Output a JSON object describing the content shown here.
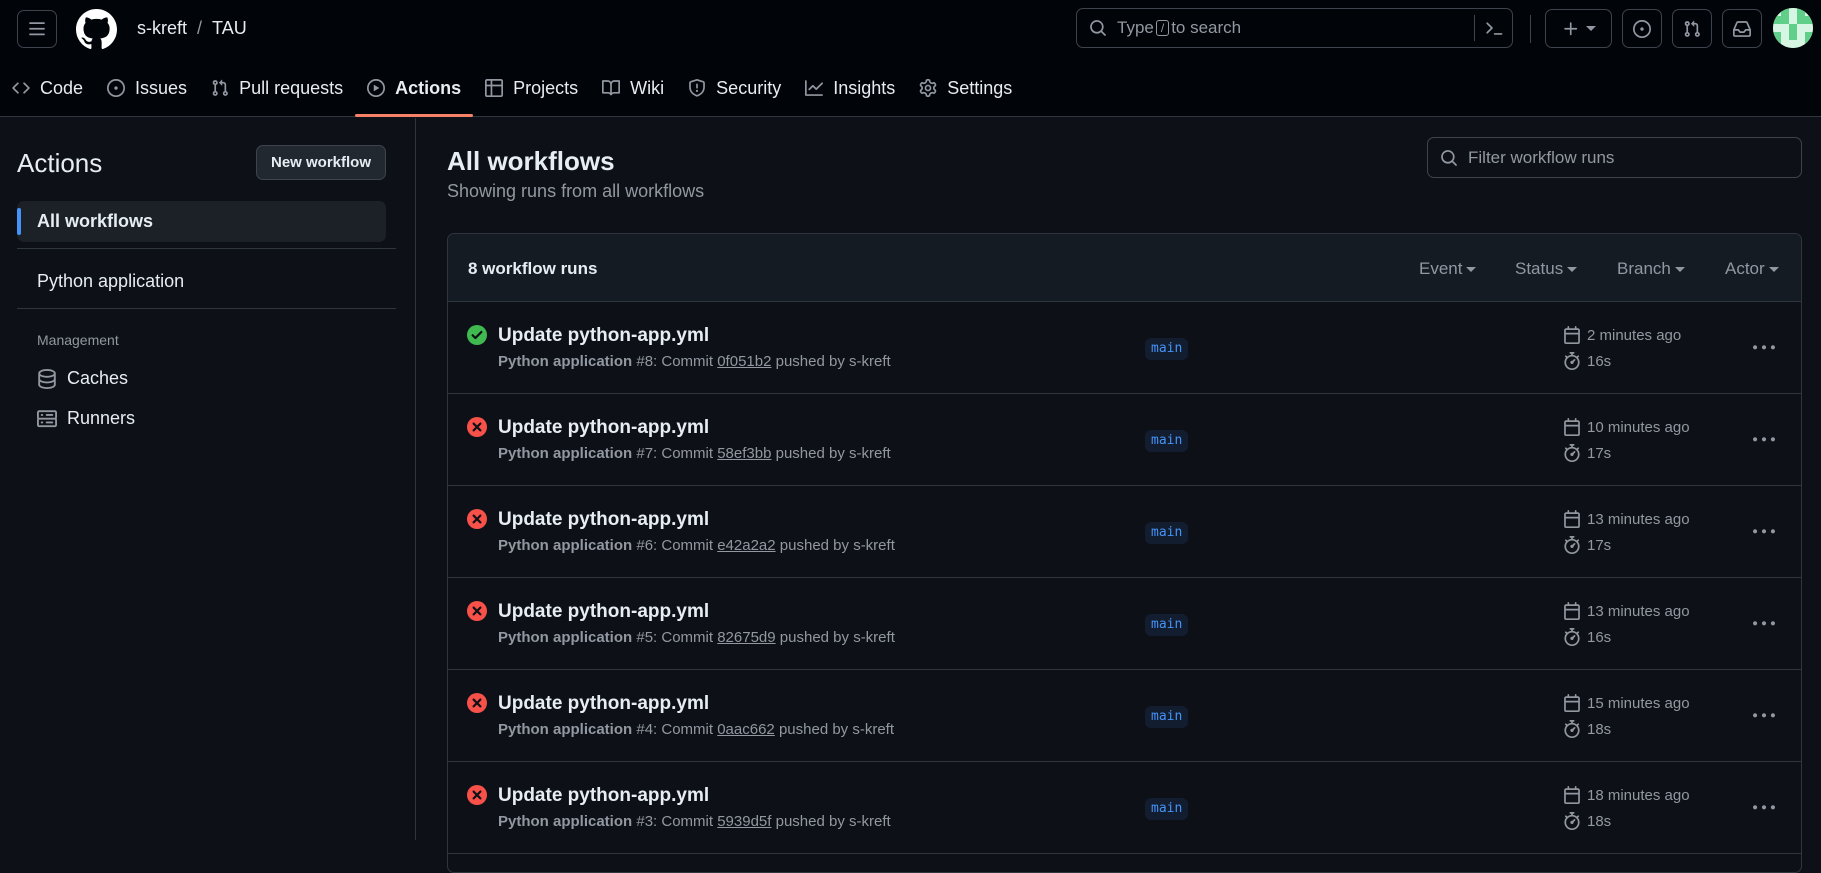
{
  "header": {
    "owner": "s-kreft",
    "separator": "/",
    "repo": "TAU",
    "search_prefix": "Type",
    "search_key": "/",
    "search_suffix": "to search"
  },
  "tabs": [
    {
      "label": "Code",
      "icon": "code-icon"
    },
    {
      "label": "Issues",
      "icon": "issue-icon"
    },
    {
      "label": "Pull requests",
      "icon": "pull-request-icon"
    },
    {
      "label": "Actions",
      "icon": "play-icon",
      "active": true
    },
    {
      "label": "Projects",
      "icon": "table-icon"
    },
    {
      "label": "Wiki",
      "icon": "book-icon"
    },
    {
      "label": "Security",
      "icon": "shield-icon"
    },
    {
      "label": "Insights",
      "icon": "graph-icon"
    },
    {
      "label": "Settings",
      "icon": "gear-icon"
    }
  ],
  "sidebar": {
    "title": "Actions",
    "new_workflow": "New workflow",
    "all_workflows": "All workflows",
    "workflow": "Python application",
    "management_label": "Management",
    "caches": "Caches",
    "runners": "Runners"
  },
  "main": {
    "title": "All workflows",
    "subtitle": "Showing runs from all workflows",
    "filter_placeholder": "Filter workflow runs",
    "runs_count": "8 workflow runs",
    "filters": [
      "Event",
      "Status",
      "Branch",
      "Actor"
    ]
  },
  "runs": [
    {
      "status": "success",
      "title": "Update python-app.yml",
      "workflow": "Python application",
      "number": "#8",
      "commit": "0f051b2",
      "actor": "s-kreft",
      "branch": "main",
      "when": "2 minutes ago",
      "duration": "16s"
    },
    {
      "status": "failure",
      "title": "Update python-app.yml",
      "workflow": "Python application",
      "number": "#7",
      "commit": "58ef3bb",
      "actor": "s-kreft",
      "branch": "main",
      "when": "10 minutes ago",
      "duration": "17s"
    },
    {
      "status": "failure",
      "title": "Update python-app.yml",
      "workflow": "Python application",
      "number": "#6",
      "commit": "e42a2a2",
      "actor": "s-kreft",
      "branch": "main",
      "when": "13 minutes ago",
      "duration": "17s"
    },
    {
      "status": "failure",
      "title": "Update python-app.yml",
      "workflow": "Python application",
      "number": "#5",
      "commit": "82675d9",
      "actor": "s-kreft",
      "branch": "main",
      "when": "13 minutes ago",
      "duration": "16s"
    },
    {
      "status": "failure",
      "title": "Update python-app.yml",
      "workflow": "Python application",
      "number": "#4",
      "commit": "0aac662",
      "actor": "s-kreft",
      "branch": "main",
      "when": "15 minutes ago",
      "duration": "18s"
    },
    {
      "status": "failure",
      "title": "Update python-app.yml",
      "workflow": "Python application",
      "number": "#3",
      "commit": "5939d5f",
      "actor": "s-kreft",
      "branch": "main",
      "when": "18 minutes ago",
      "duration": "18s"
    }
  ],
  "colors": {
    "success": "#3fb950",
    "failure": "#f85149",
    "accent": "#4493f8",
    "tab_underline": "#f78166"
  }
}
